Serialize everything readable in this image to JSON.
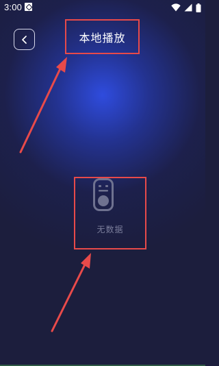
{
  "status_bar": {
    "time": "3:00",
    "app_icon": "notification-app-icon",
    "icons": [
      "wifi-icon",
      "signal-icon",
      "battery-icon"
    ]
  },
  "header": {
    "back_icon": "chevron-left-icon",
    "title": "本地播放"
  },
  "empty_state": {
    "icon": "remote-control-icon",
    "text": "无数据"
  },
  "colors": {
    "background": "#1c1e3d",
    "glow": "#304ee6",
    "annotation_red": "#e84a4a",
    "muted_text": "#7b7e9b"
  }
}
